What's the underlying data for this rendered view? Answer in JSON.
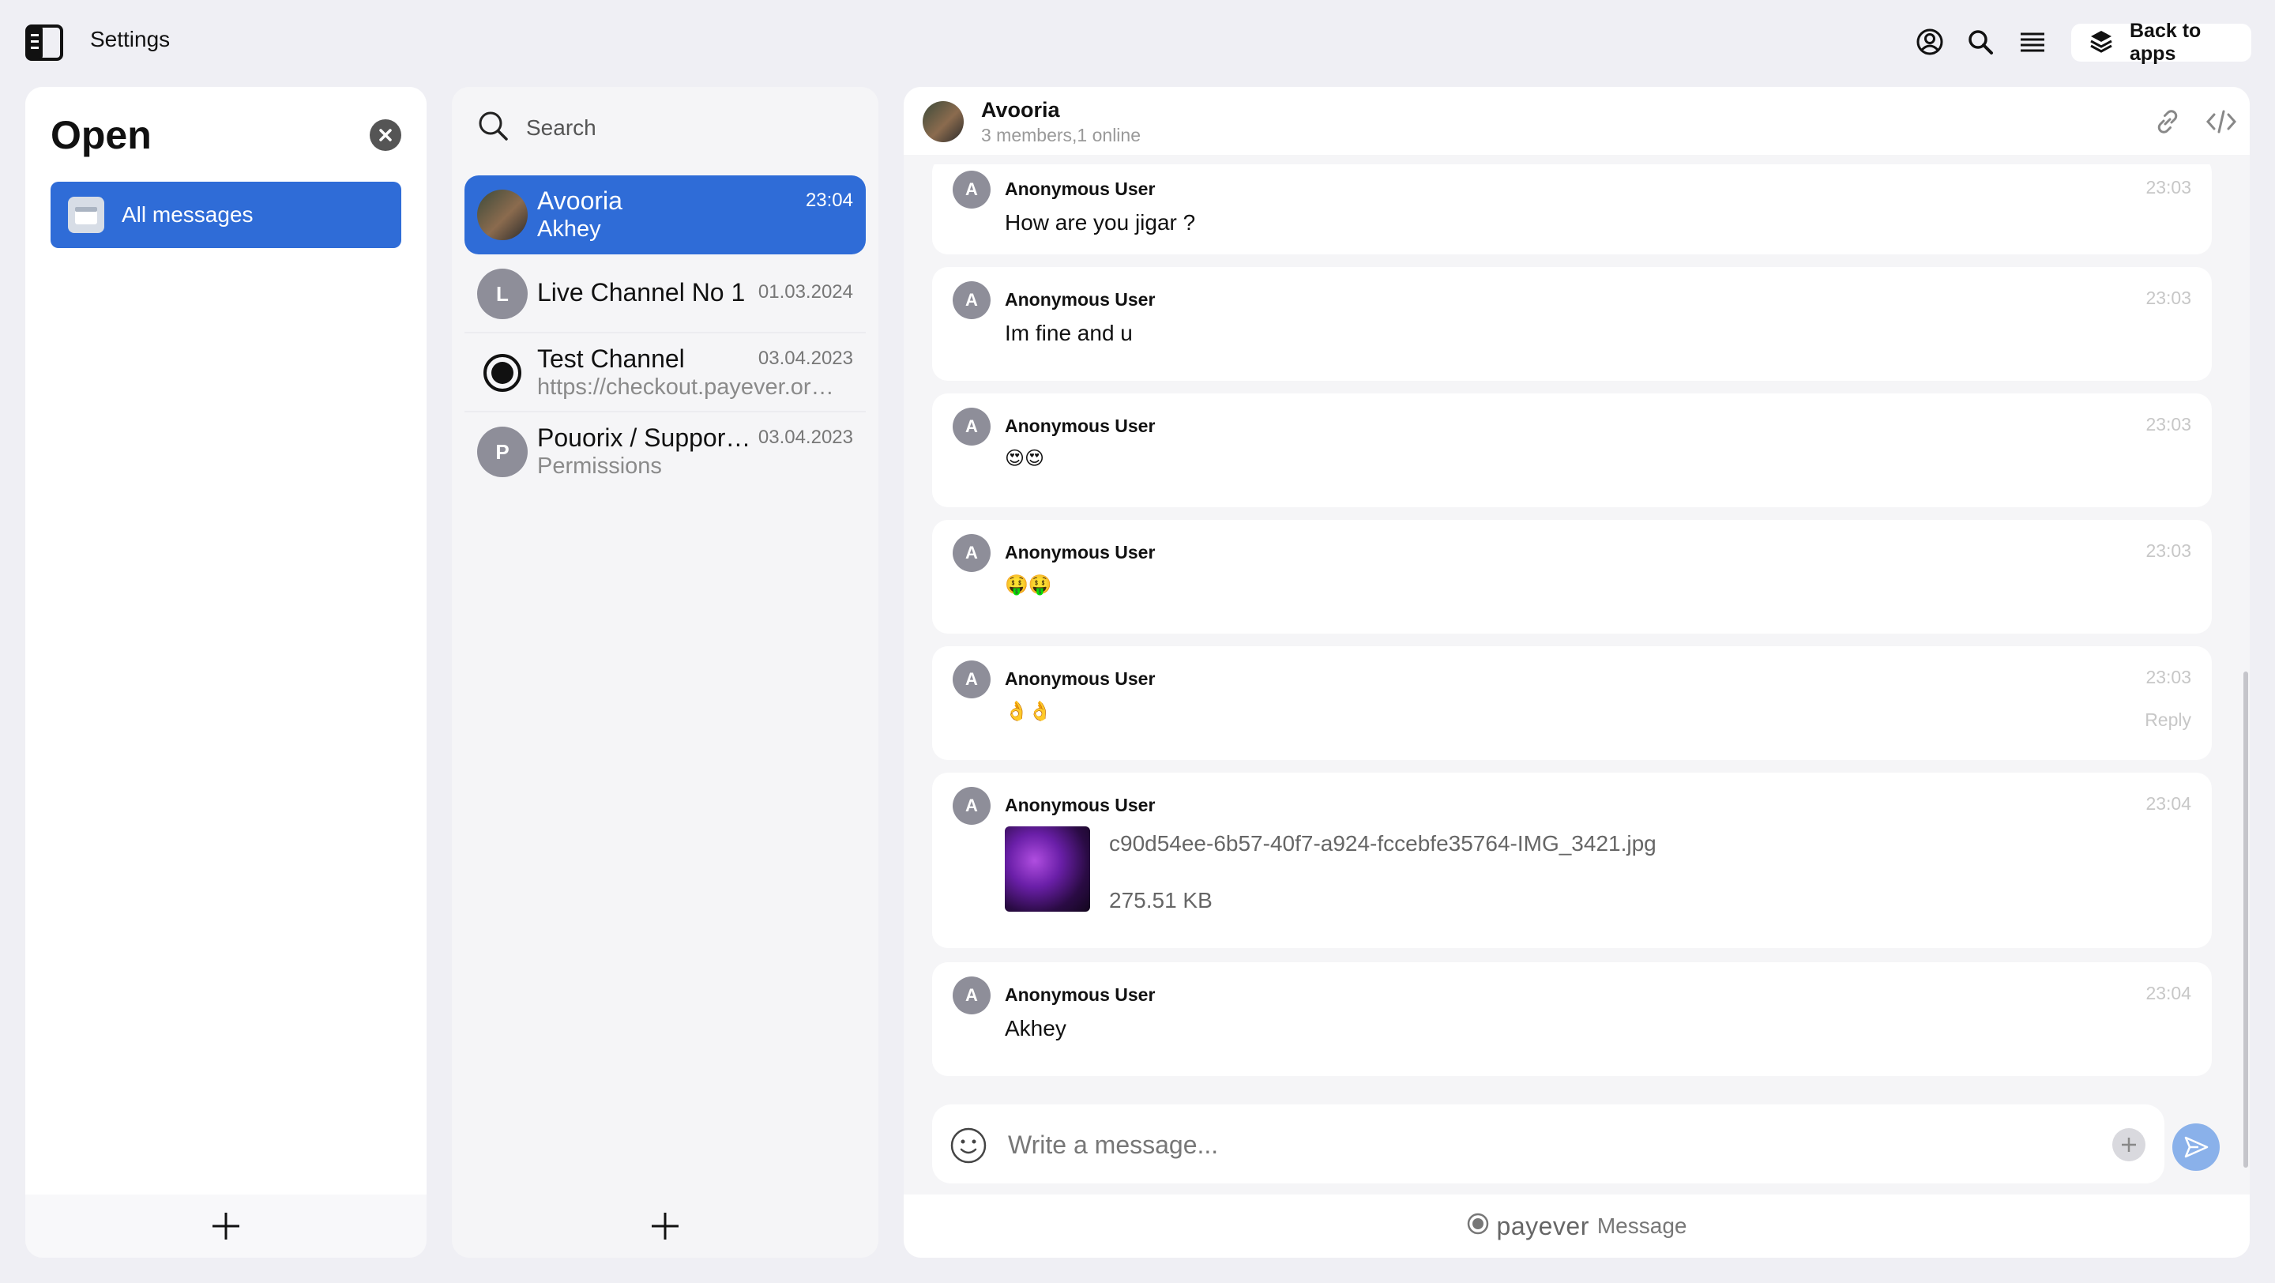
{
  "app": {
    "title": "Settings"
  },
  "topbar": {
    "back_label": "Back to apps"
  },
  "colors": {
    "accent": "#2f6cd7",
    "send": "#8ab1ea",
    "avatar_gray": "#8e8e99"
  },
  "left_panel": {
    "title": "Open",
    "folders": [
      {
        "label": "All messages",
        "icon": "folder-icon",
        "active": true
      }
    ]
  },
  "conversations_panel": {
    "search_placeholder": "Search",
    "items": [
      {
        "title": "Avooria",
        "subtitle": "Akhey",
        "time": "23:04",
        "avatar": "photo",
        "active": true
      },
      {
        "title": "Live Channel No 1",
        "subtitle": "",
        "time": "01.03.2024",
        "avatar": "L"
      },
      {
        "title": "Test Channel",
        "subtitle": "https://checkout.payever.org/pay/...",
        "time": "03.04.2023",
        "avatar": "record-icon"
      },
      {
        "title": "Pouorix / Support Channel",
        "subtitle": "Permissions",
        "time": "03.04.2023",
        "avatar": "P"
      }
    ]
  },
  "chat": {
    "title": "Avooria",
    "subtitle": "3 members,1 online",
    "messages": [
      {
        "author": "Anonymous User",
        "initial": "A",
        "text": "How are you jigar ?",
        "time": "23:03"
      },
      {
        "author": "Anonymous User",
        "initial": "A",
        "text": "Im fine and u",
        "time": "23:03"
      },
      {
        "author": "Anonymous User",
        "initial": "A",
        "text": "😍😍",
        "time": "23:03"
      },
      {
        "author": "Anonymous User",
        "initial": "A",
        "text": "🤑🤑",
        "time": "23:03"
      },
      {
        "author": "Anonymous User",
        "initial": "A",
        "text": "👌👌",
        "time": "23:03",
        "reply": "Reply"
      },
      {
        "author": "Anonymous User",
        "initial": "A",
        "time": "23:04",
        "file_name": "c90d54ee-6b57-40f7-a924-fccebfe35764-IMG_3421.jpg",
        "file_size": "275.51 KB"
      },
      {
        "author": "Anonymous User",
        "initial": "A",
        "text": "Akhey",
        "time": "23:04"
      }
    ],
    "composer_placeholder": "Write a message...",
    "footer_brand": "payever",
    "footer_product": "Message"
  }
}
